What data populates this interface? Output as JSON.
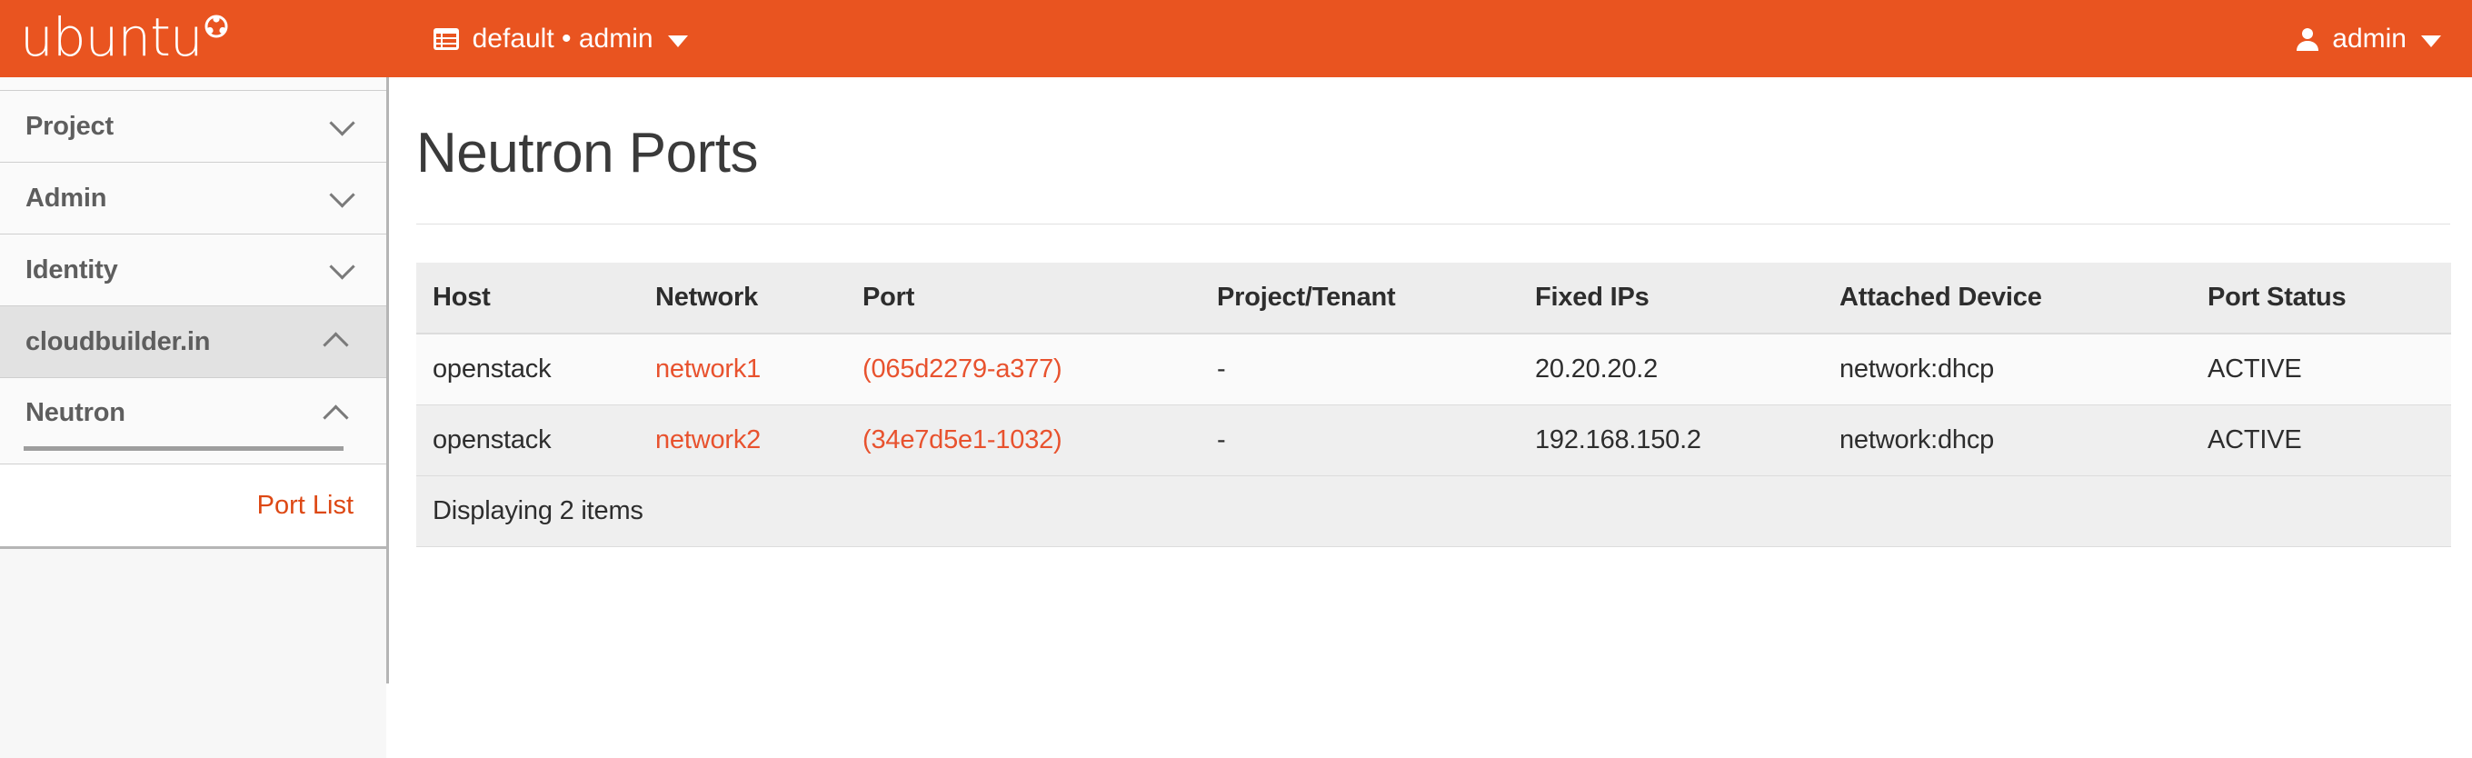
{
  "topbar": {
    "brand": "ubuntu",
    "brand_mark_icon": "ubuntu-circle-of-friends-icon",
    "context_icon": "list-grid-icon",
    "context_label": "default • admin",
    "context_caret_icon": "caret-down-icon",
    "user_icon": "user-avatar-icon",
    "user_label": "admin",
    "user_caret_icon": "caret-down-icon",
    "background_color": "#e95420"
  },
  "sidebar": {
    "items": [
      {
        "label": "Project",
        "state": "collapsed",
        "chevron_icon": "chevron-down-icon"
      },
      {
        "label": "Admin",
        "state": "collapsed",
        "chevron_icon": "chevron-down-icon"
      },
      {
        "label": "Identity",
        "state": "collapsed",
        "chevron_icon": "chevron-down-icon"
      },
      {
        "label": "cloudbuilder.in",
        "state": "expanded",
        "chevron_icon": "chevron-up-icon"
      },
      {
        "label": "Neutron",
        "state": "expanded",
        "chevron_icon": "chevron-up-icon"
      }
    ],
    "leaf": {
      "label": "Port List",
      "active": true,
      "color": "#dd4814"
    }
  },
  "main": {
    "page_title": "Neutron Ports",
    "table": {
      "columns": [
        "Host",
        "Network",
        "Port",
        "Project/Tenant",
        "Fixed IPs",
        "Attached Device",
        "Port Status"
      ],
      "rows": [
        {
          "host": "openstack",
          "network": "network1",
          "port": "(065d2279-a377)",
          "tenant": "-",
          "fixed_ips": "20.20.20.2",
          "attached_device": "network:dhcp",
          "port_status": "ACTIVE"
        },
        {
          "host": "openstack",
          "network": "network2",
          "port": "(34e7d5e1-1032)",
          "tenant": "-",
          "fixed_ips": "192.168.150.2",
          "attached_device": "network:dhcp",
          "port_status": "ACTIVE"
        }
      ],
      "footer": "Displaying 2 items",
      "link_color": "#e8522e"
    }
  }
}
